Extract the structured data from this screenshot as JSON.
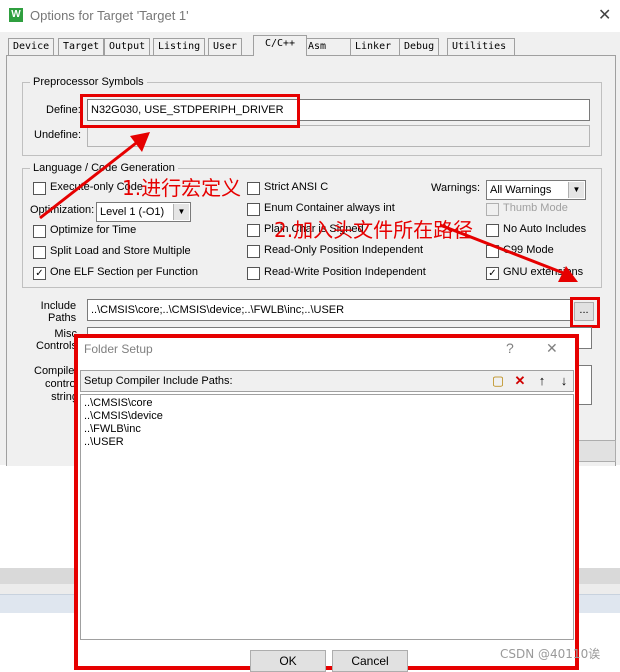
{
  "window": {
    "title": "Options for Target 'Target 1'",
    "app_icon": "W"
  },
  "tabs": [
    {
      "label": "Device"
    },
    {
      "label": "Target"
    },
    {
      "label": "Output"
    },
    {
      "label": "Listing"
    },
    {
      "label": "User"
    },
    {
      "label": "C/C++"
    },
    {
      "label": "Asm"
    },
    {
      "label": "Linker"
    },
    {
      "label": "Debug"
    },
    {
      "label": "Utilities"
    }
  ],
  "preprocessor": {
    "group_title": "Preprocessor Symbols",
    "define_label": "Define:",
    "define_value": "N32G030, USE_STDPERIPH_DRIVER",
    "undefine_label": "Undefine:",
    "undefine_value": ""
  },
  "language": {
    "group_title": "Language / Code Generation",
    "execute_only": "Execute-only Code",
    "optimization_label": "Optimization:",
    "optimization_value": "Level 1 (-O1)",
    "optimize_time": "Optimize for Time",
    "split_load": "Split Load and Store Multiple",
    "one_elf": "One ELF Section per Function",
    "strict_ansi": "Strict ANSI C",
    "enum_container": "Enum Container always int",
    "plain_char": "Plain Char is Signed",
    "ro_pi": "Read-Only Position Independent",
    "rw_pi": "Read-Write Position Independent",
    "warnings_label": "Warnings:",
    "warnings_value": "All Warnings",
    "thumb_mode": "Thumb Mode",
    "no_auto_includes": "No Auto Includes",
    "c99_mode": "C99 Mode",
    "gnu_extensions": "GNU extensions"
  },
  "include": {
    "label_line1": "Include",
    "label_line2": "Paths",
    "value": "..\\CMSIS\\core;..\\CMSIS\\device;..\\FWLB\\inc;..\\USER",
    "browse_label": "...",
    "misc_label_line1": "Misc",
    "misc_label_line2": "Controls",
    "compiler_label_line1": "Compiler",
    "compiler_label_line2": "control",
    "compiler_label_line3": "string"
  },
  "annotations": {
    "step1": "1.进行宏定义",
    "step2": "2.加入头文件所在路径"
  },
  "folder_setup": {
    "title": "Folder Setup",
    "help": "?",
    "close": "✕",
    "header": "Setup Compiler Include Paths:",
    "paths": [
      "..\\CMSIS\\core",
      "..\\CMSIS\\device",
      "..\\FWLB\\inc",
      "..\\USER"
    ],
    "ok_label": "OK",
    "cancel_label": "Cancel"
  },
  "watermark": "CSDN @40110诶",
  "colors": {
    "annotation_red": "#e60000",
    "checkbox_green": "#2f9f3f"
  }
}
